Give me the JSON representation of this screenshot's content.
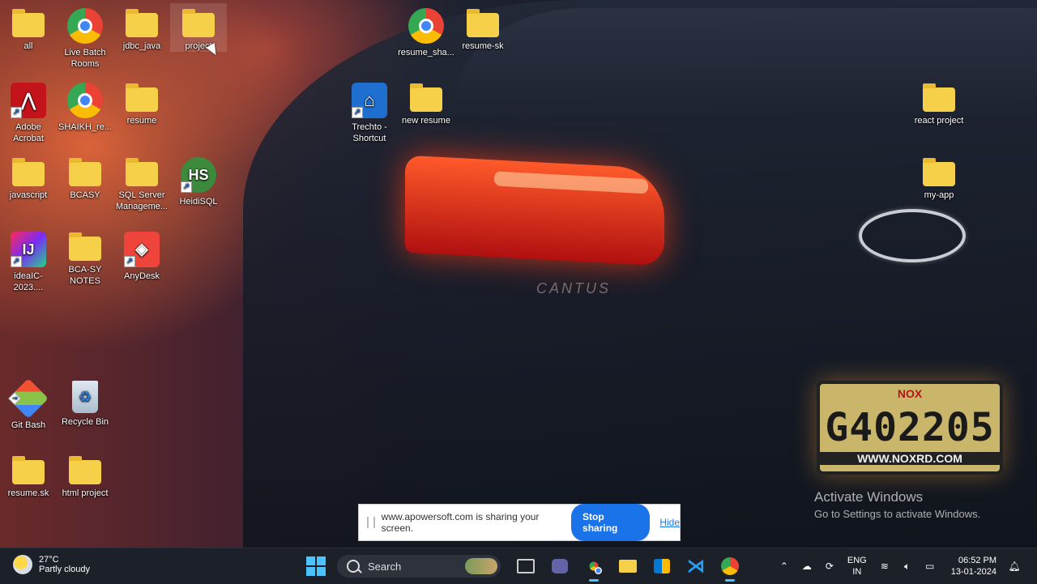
{
  "desktop_icons": [
    {
      "label": "all",
      "kind": "folder"
    },
    {
      "label": "Live Batch Rooms",
      "kind": "chrome"
    },
    {
      "label": "jdbc_java",
      "kind": "folder"
    },
    {
      "label": "project",
      "kind": "folder"
    },
    {
      "label": "resume_sha...",
      "kind": "chrome"
    },
    {
      "label": "resume-sk",
      "kind": "folder"
    },
    {
      "label": "Adobe Acrobat",
      "kind": "acrobat"
    },
    {
      "label": "SHAIKH_re...",
      "kind": "chrome"
    },
    {
      "label": "resume",
      "kind": "folder"
    },
    {
      "label": "Trechto - Shortcut",
      "kind": "trechto"
    },
    {
      "label": "new resume",
      "kind": "folder"
    },
    {
      "label": "react project",
      "kind": "folder"
    },
    {
      "label": "javascript",
      "kind": "folder"
    },
    {
      "label": "BCASY",
      "kind": "folder"
    },
    {
      "label": "SQL Server Manageme...",
      "kind": "folder"
    },
    {
      "label": "HeidiSQL",
      "kind": "heidisql",
      "glyph_text": "HS"
    },
    {
      "label": "my-app",
      "kind": "folder"
    },
    {
      "label": "ideaIC-2023....",
      "kind": "intellij",
      "glyph_text": "IJ"
    },
    {
      "label": "BCA-SY NOTES",
      "kind": "folder"
    },
    {
      "label": "AnyDesk",
      "kind": "anydesk"
    },
    {
      "label": "Git Bash",
      "kind": "gitbash"
    },
    {
      "label": "Recycle Bin",
      "kind": "recycle"
    },
    {
      "label": "resume.sk",
      "kind": "folder"
    },
    {
      "label": "html project",
      "kind": "folder"
    }
  ],
  "wallpaper": {
    "plate_brand": "NOX",
    "plate_number": "G402205",
    "plate_url": "WWW.NOXRD.COM",
    "model_badge": "CANTUS"
  },
  "share_bar": {
    "message": "www.apowersoft.com is sharing your screen.",
    "stop_label": "Stop sharing",
    "hide_label": "Hide"
  },
  "watermark": {
    "title": "Activate Windows",
    "subtitle": "Go to Settings to activate Windows."
  },
  "taskbar": {
    "weather_temp": "27°C",
    "weather_desc": "Partly cloudy",
    "search_placeholder": "Search",
    "lang_top": "ENG",
    "lang_bottom": "IN",
    "time": "06:52 PM",
    "date": "13-01-2024"
  },
  "colors": {
    "accent": "#1a73e8",
    "folder": "#f7d04a",
    "taskbar": "#1c2029"
  }
}
